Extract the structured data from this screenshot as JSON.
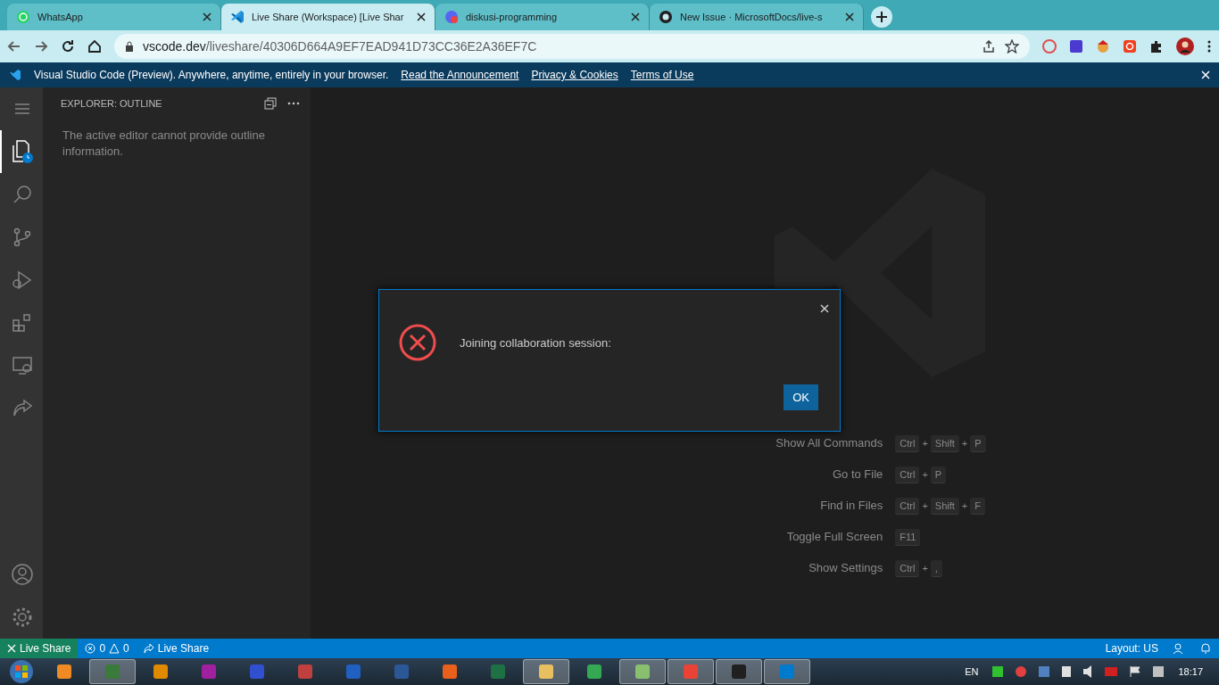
{
  "browser": {
    "tabs": [
      {
        "title": "WhatsApp",
        "kind": "whatsapp",
        "selected": false
      },
      {
        "title": "Live Share (Workspace) [Live Shar",
        "kind": "vscode",
        "selected": true
      },
      {
        "title": "diskusi-programming",
        "kind": "discord",
        "selected": false
      },
      {
        "title": "New Issue · MicrosoftDocs/live-s",
        "kind": "github",
        "selected": false
      }
    ],
    "url_host": "vscode.dev",
    "url_path": "/liveshare/40306D664A9EF7EAD941D73CC36E2A36EF7C"
  },
  "banner": {
    "text": "Visual Studio Code (Preview). Anywhere, anytime, entirely in your browser.",
    "links": [
      "Read the Announcement",
      "Privacy & Cookies",
      "Terms of Use"
    ]
  },
  "activity_bar": [
    {
      "kind": "explorer",
      "selected": true
    },
    {
      "kind": "search",
      "selected": false
    },
    {
      "kind": "source-control",
      "selected": false
    },
    {
      "kind": "run",
      "selected": false
    },
    {
      "kind": "extensions",
      "selected": false
    },
    {
      "kind": "remote",
      "selected": false
    },
    {
      "kind": "live-share",
      "selected": false
    }
  ],
  "sidebar": {
    "title": "EXPLORER: OUTLINE",
    "message": "The active editor cannot provide outline information."
  },
  "shortcuts": [
    {
      "label": "Show All Commands",
      "keys": [
        "Ctrl",
        "+",
        "Shift",
        "+",
        "P"
      ]
    },
    {
      "label": "Go to File",
      "keys": [
        "Ctrl",
        "+",
        "P"
      ]
    },
    {
      "label": "Find in Files",
      "keys": [
        "Ctrl",
        "+",
        "Shift",
        "+",
        "F"
      ]
    },
    {
      "label": "Toggle Full Screen",
      "keys": [
        "F11"
      ]
    },
    {
      "label": "Show Settings",
      "keys": [
        "Ctrl",
        "+",
        ","
      ]
    }
  ],
  "dialog": {
    "message": "Joining collaboration session:",
    "button": "OK"
  },
  "status_bar": {
    "remote": "Live Share",
    "errors": "0",
    "warnings": "0",
    "live_share": "Live Share",
    "layout": "Layout: US"
  },
  "taskbar": {
    "apps": [
      {
        "color": "#f08a24",
        "open": false
      },
      {
        "color": "#3a7a3a",
        "open": true
      },
      {
        "color": "#e08a00",
        "open": false
      },
      {
        "color": "#a020a0",
        "open": false
      },
      {
        "color": "#3050d0",
        "open": false
      },
      {
        "color": "#c04040",
        "open": false
      },
      {
        "color": "#2060c0",
        "open": false
      },
      {
        "color": "#2b5797",
        "open": false
      },
      {
        "color": "#e8601c",
        "open": false
      },
      {
        "color": "#1e7145",
        "open": false
      },
      {
        "color": "#e8c060",
        "open": true
      },
      {
        "color": "#34a853",
        "open": false
      },
      {
        "color": "#88c070",
        "open": true
      },
      {
        "color": "#ea4335",
        "open": true
      },
      {
        "color": "#202020",
        "open": true
      },
      {
        "color": "#007acc",
        "open": true
      }
    ],
    "language": "EN",
    "clock": "18:17"
  }
}
